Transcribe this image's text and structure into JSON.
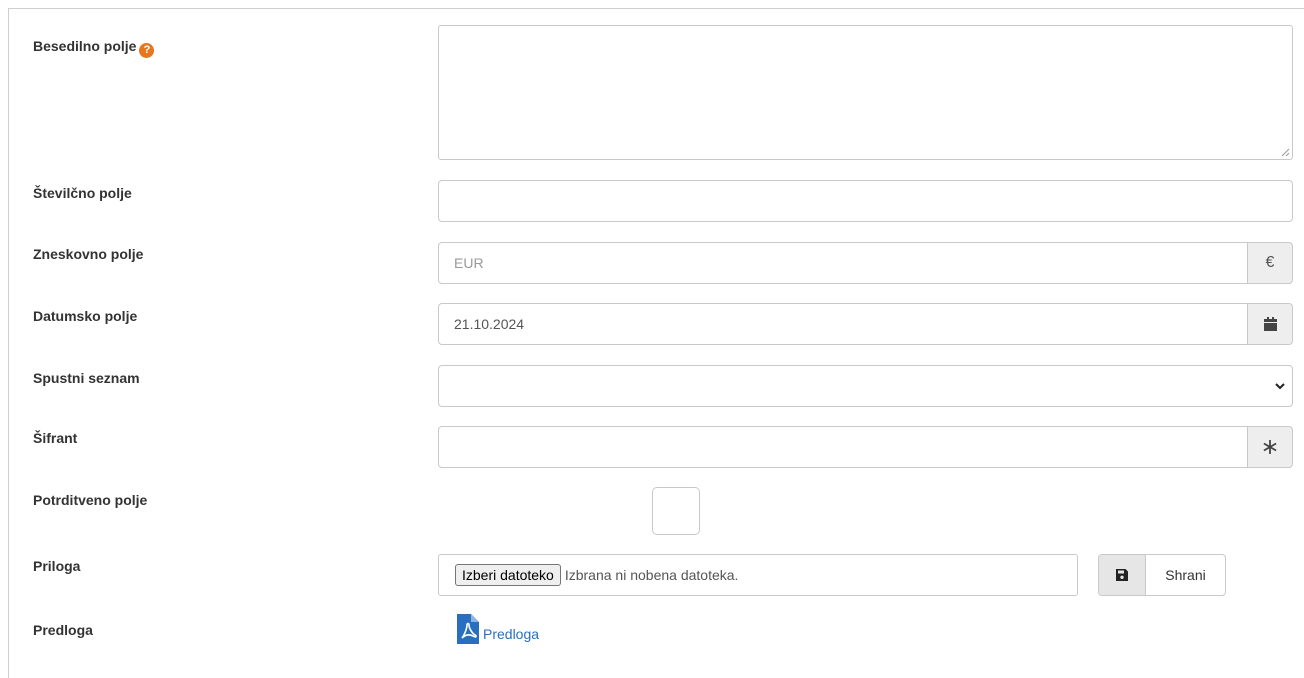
{
  "fields": {
    "besedilno": {
      "label": "Besedilno polje",
      "help_icon": "question-circle-icon",
      "value": ""
    },
    "stevilcno": {
      "label": "Številčno polje",
      "value": ""
    },
    "zneskovno": {
      "label": "Zneskovno polje",
      "placeholder": "EUR",
      "addon_symbol": "€"
    },
    "datumsko": {
      "label": "Datumsko polje",
      "value": "21.10.2024",
      "addon_icon": "calendar-icon"
    },
    "spustni": {
      "label": "Spustni seznam",
      "selected": "",
      "icon": "chevron-down-icon"
    },
    "sifrant": {
      "label": "Šifrant",
      "value": "",
      "addon_symbol": "∗"
    },
    "potrditveno": {
      "label": "Potrditveno polje",
      "checked": false
    },
    "priloga": {
      "label": "Priloga",
      "file_button": "Izberi datoteko",
      "file_status": "Izbrana ni nobena datoteka.",
      "save_icon": "floppy-disk-icon",
      "save_label": "Shrani"
    },
    "predloga": {
      "label": "Predloga",
      "link_text": "Predloga",
      "icon": "pdf-file-icon"
    }
  },
  "colors": {
    "help_icon": "#e8761e",
    "link": "#2a6fbf",
    "border": "#c9c9c9",
    "addon_bg": "#eeeeee"
  }
}
